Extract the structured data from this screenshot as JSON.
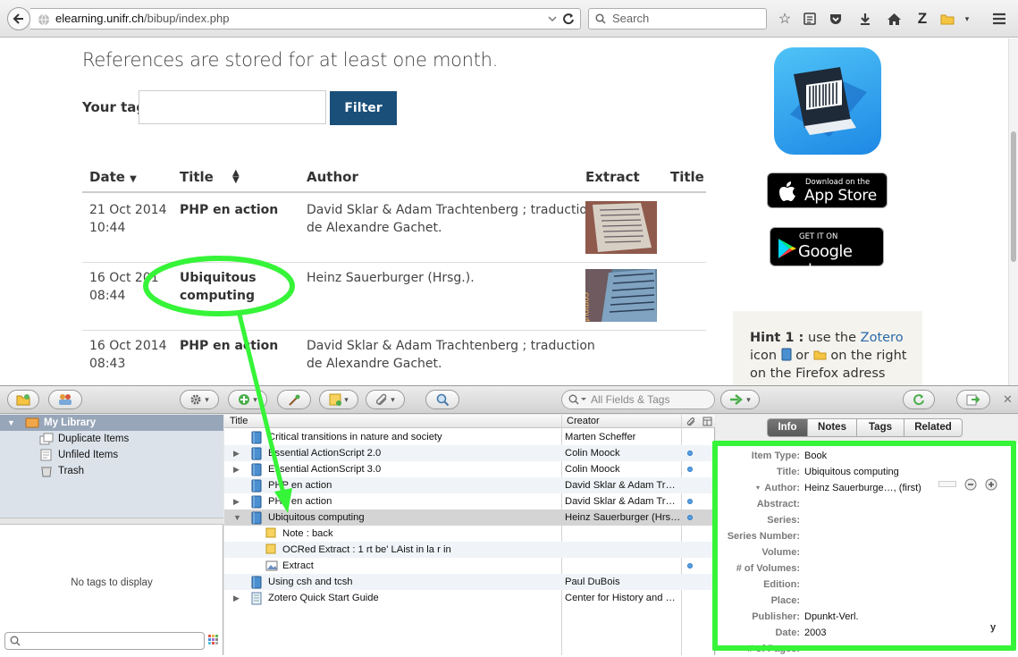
{
  "browser": {
    "url_host": "elearning.unifr.ch",
    "url_path": "/bibup/index.php",
    "url_prefix": "",
    "search_placeholder": "Search",
    "zotero_letter": "Z"
  },
  "page": {
    "notice": "References are stored for at least one month.",
    "tag_label": "Your tag",
    "tag_value": "",
    "filter_button": "Filter",
    "table": {
      "headers": {
        "date": "Date",
        "title": "Title",
        "author": "Author",
        "extract": "Extract",
        "title2": "Title"
      },
      "rows": [
        {
          "date": "21 Oct 2014",
          "time": "10:44",
          "title_l1": "PHP en action",
          "title_l2": "",
          "author_l1": "David Sklar & Adam Trachtenberg ; traduction",
          "author_l2": "de Alexandre Gachet."
        },
        {
          "date": "16 Oct 201",
          "time": "08:44",
          "title_l1": "Ubiquitous",
          "title_l2": "computing",
          "author_l1": "Heinz Sauerburger (Hrsg.).",
          "author_l2": ""
        },
        {
          "date": "16 Oct 2014",
          "time": "08:43",
          "title_l1": "PHP en action",
          "title_l2": "",
          "author_l1": "David Sklar & Adam Trachtenberg ; traduction",
          "author_l2": "de Alexandre Gachet."
        }
      ]
    },
    "app_store": {
      "small": "Download on the",
      "big": "App Store"
    },
    "google_play": {
      "small": "GET IT ON",
      "big": "Google play"
    },
    "hint": {
      "label": "Hint 1 :",
      "t1": " use the ",
      "link": "Zotero",
      "t2": "icon",
      "t3": " or ",
      "t4": " on the right on the Firefox adress bar"
    }
  },
  "zotero": {
    "search_placeholder": "All Fields & Tags",
    "collections": {
      "my_library": "My Library",
      "items": [
        "Duplicate Items",
        "Unfiled Items",
        "Trash"
      ]
    },
    "tags_empty": "No tags to display",
    "columns": {
      "title": "Title",
      "creator": "Creator"
    },
    "items": [
      {
        "title": "Critical transitions in nature and society",
        "creator": "Marten Scheffer",
        "twisty": "",
        "attach": false
      },
      {
        "title": "Essential ActionScript 2.0",
        "creator": "Colin Moock",
        "twisty": "▶",
        "attach": true
      },
      {
        "title": "Essential ActionScript 3.0",
        "creator": "Colin Moock",
        "twisty": "▶",
        "attach": true
      },
      {
        "title": "PHP en action",
        "creator": "David Sklar & Adam Tr…",
        "twisty": "",
        "attach": false
      },
      {
        "title": "PHP en action",
        "creator": "David Sklar & Adam Tr…",
        "twisty": "▶",
        "attach": true
      },
      {
        "title": "Ubiquitous computing",
        "creator": "Heinz Sauerburger (Hrs…",
        "twisty": "▼",
        "attach": true
      },
      {
        "title": "Note : back",
        "creator": "",
        "twisty": "",
        "attach": false
      },
      {
        "title": "OCRed Extract : 1 rt be' LAist in la r in",
        "creator": "",
        "twisty": "",
        "attach": false
      },
      {
        "title": "Extract",
        "creator": "",
        "twisty": "",
        "attach": true
      },
      {
        "title": "Using csh and tcsh",
        "creator": "Paul DuBois",
        "twisty": "",
        "attach": false
      },
      {
        "title": "Zotero Quick Start Guide",
        "creator": "Center for History and …",
        "twisty": "▶",
        "attach": false
      }
    ],
    "tabs": [
      "Info",
      "Notes",
      "Tags",
      "Related"
    ],
    "fields": [
      {
        "label": "Item Type:",
        "value": "Book"
      },
      {
        "label": "Title:",
        "value": "Ubiquitous computing"
      },
      {
        "label": "Author:",
        "value": "Heinz Sauerburge…, (first)"
      },
      {
        "label": "Abstract:",
        "value": ""
      },
      {
        "label": "Series:",
        "value": ""
      },
      {
        "label": "Series Number:",
        "value": ""
      },
      {
        "label": "Volume:",
        "value": ""
      },
      {
        "label": "# of Volumes:",
        "value": ""
      },
      {
        "label": "Edition:",
        "value": ""
      },
      {
        "label": "Place:",
        "value": ""
      },
      {
        "label": "Publisher:",
        "value": "Dpunkt-Verl."
      },
      {
        "label": "Date:",
        "value": "2003"
      },
      {
        "label": "# of Pages:",
        "value": ""
      }
    ],
    "date_suffix": "y"
  },
  "colors": {
    "accent_green": "#36f438",
    "filter_blue": "#1a4f7a",
    "selection": "#d4d4d4"
  }
}
